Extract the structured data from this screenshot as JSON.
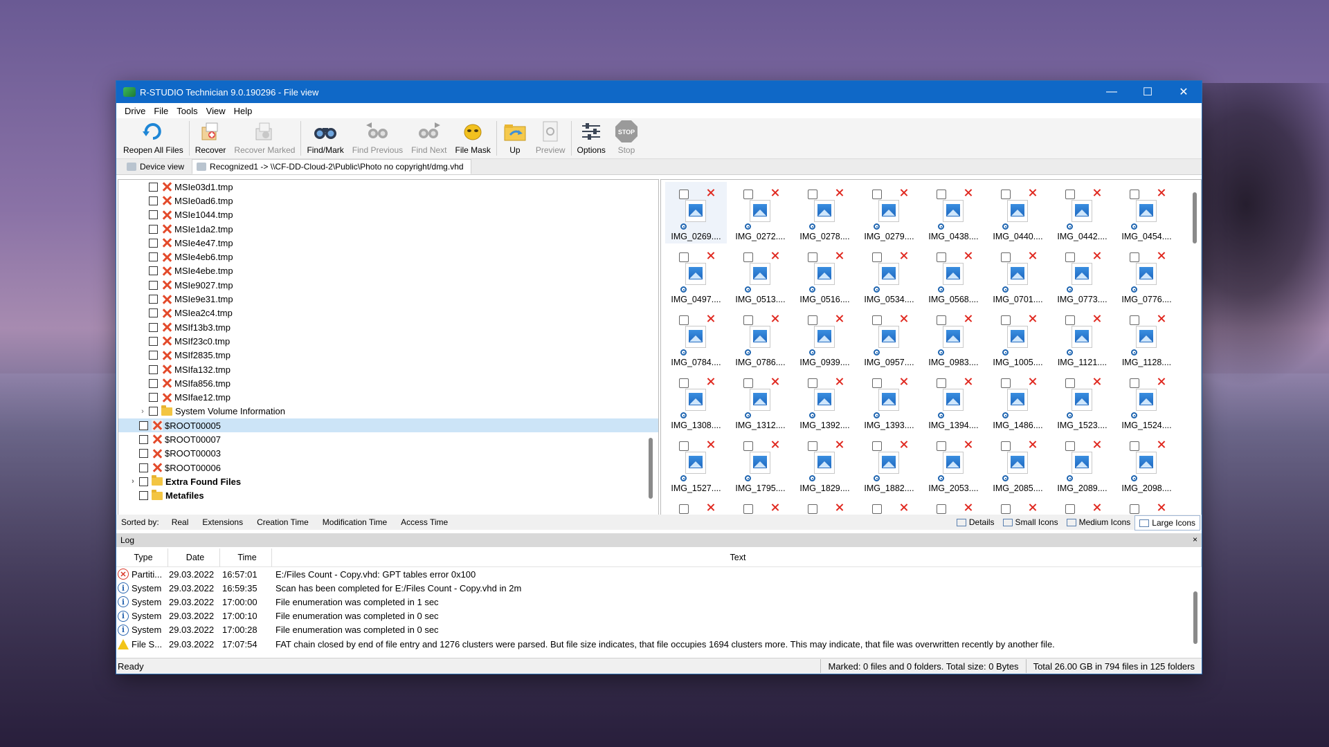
{
  "window": {
    "title": "R-STUDIO Technician 9.0.190296 - File view",
    "controls": {
      "minimize": "—",
      "maximize": "☐",
      "close": "✕"
    }
  },
  "menu": [
    "Drive",
    "File",
    "Tools",
    "View",
    "Help"
  ],
  "toolbar": [
    {
      "label": "Reopen All Files",
      "icon": "refresh-icon",
      "enabled": true
    },
    {
      "label": "Recover",
      "icon": "recover-icon",
      "enabled": true
    },
    {
      "label": "Recover Marked",
      "icon": "recover-marked-icon",
      "enabled": false
    },
    {
      "label": "Find/Mark",
      "icon": "binoculars-icon",
      "enabled": true
    },
    {
      "label": "Find Previous",
      "icon": "find-previous-icon",
      "enabled": false
    },
    {
      "label": "Find Next",
      "icon": "find-next-icon",
      "enabled": false
    },
    {
      "label": "File Mask",
      "icon": "file-mask-icon",
      "enabled": true
    },
    {
      "label": "Up",
      "icon": "folder-up-icon",
      "enabled": true
    },
    {
      "label": "Preview",
      "icon": "preview-icon",
      "enabled": false
    },
    {
      "label": "Options",
      "icon": "options-icon",
      "enabled": true
    },
    {
      "label": "Stop",
      "icon": "stop-icon",
      "enabled": false,
      "icon_text": "STOP"
    }
  ],
  "tabs": [
    {
      "label": "Device view",
      "active": false
    },
    {
      "label": "Recognized1 -> \\\\CF-DD-Cloud-2\\Public\\Photo no copyright/dmg.vhd",
      "active": true
    }
  ],
  "tree": [
    {
      "name": "MSIe03d1.tmp",
      "indent": 2,
      "kind": "deleted"
    },
    {
      "name": "MSIe0ad6.tmp",
      "indent": 2,
      "kind": "deleted"
    },
    {
      "name": "MSIe1044.tmp",
      "indent": 2,
      "kind": "deleted"
    },
    {
      "name": "MSIe1da2.tmp",
      "indent": 2,
      "kind": "deleted"
    },
    {
      "name": "MSIe4e47.tmp",
      "indent": 2,
      "kind": "deleted"
    },
    {
      "name": "MSIe4eb6.tmp",
      "indent": 2,
      "kind": "deleted"
    },
    {
      "name": "MSIe4ebe.tmp",
      "indent": 2,
      "kind": "deleted"
    },
    {
      "name": "MSIe9027.tmp",
      "indent": 2,
      "kind": "deleted"
    },
    {
      "name": "MSIe9e31.tmp",
      "indent": 2,
      "kind": "deleted"
    },
    {
      "name": "MSIea2c4.tmp",
      "indent": 2,
      "kind": "deleted"
    },
    {
      "name": "MSIf13b3.tmp",
      "indent": 2,
      "kind": "deleted"
    },
    {
      "name": "MSIf23c0.tmp",
      "indent": 2,
      "kind": "deleted"
    },
    {
      "name": "MSIf2835.tmp",
      "indent": 2,
      "kind": "deleted"
    },
    {
      "name": "MSIfa132.tmp",
      "indent": 2,
      "kind": "deleted"
    },
    {
      "name": "MSIfa856.tmp",
      "indent": 2,
      "kind": "deleted"
    },
    {
      "name": "MSIfae12.tmp",
      "indent": 2,
      "kind": "deleted"
    },
    {
      "name": "System Volume Information",
      "indent": 2,
      "kind": "folder",
      "expandable": true
    },
    {
      "name": "$ROOT00005",
      "indent": 1,
      "kind": "deleted-doc",
      "selected": true
    },
    {
      "name": "$ROOT00007",
      "indent": 1,
      "kind": "deleted"
    },
    {
      "name": "$ROOT00003",
      "indent": 1,
      "kind": "deleted"
    },
    {
      "name": "$ROOT00006",
      "indent": 1,
      "kind": "deleted"
    },
    {
      "name": "Extra Found Files",
      "indent": 1,
      "kind": "folder",
      "expandable": true,
      "bold": true
    },
    {
      "name": "Metafiles",
      "indent": 1,
      "kind": "folder",
      "bold": true
    }
  ],
  "thumbnails": [
    "IMG_0269....",
    "IMG_0272....",
    "IMG_0278....",
    "IMG_0279....",
    "IMG_0438....",
    "IMG_0440....",
    "IMG_0442....",
    "IMG_0454....",
    "IMG_0497....",
    "IMG_0513....",
    "IMG_0516....",
    "IMG_0534....",
    "IMG_0568....",
    "IMG_0701....",
    "IMG_0773....",
    "IMG_0776....",
    "IMG_0784....",
    "IMG_0786....",
    "IMG_0939....",
    "IMG_0957....",
    "IMG_0983....",
    "IMG_1005....",
    "IMG_1121....",
    "IMG_1128....",
    "IMG_1308....",
    "IMG_1312....",
    "IMG_1392....",
    "IMG_1393....",
    "IMG_1394....",
    "IMG_1486....",
    "IMG_1523....",
    "IMG_1524....",
    "IMG_1527....",
    "IMG_1795....",
    "IMG_1829....",
    "IMG_1882....",
    "IMG_2053....",
    "IMG_2085....",
    "IMG_2089....",
    "IMG_2098....",
    "",
    "",
    "",
    "",
    "",
    "",
    "",
    ""
  ],
  "sort": {
    "label": "Sorted by:",
    "options": [
      "Real",
      "Extensions",
      "Creation Time",
      "Modification Time",
      "Access Time"
    ]
  },
  "views": [
    {
      "label": "Details",
      "active": false
    },
    {
      "label": "Small Icons",
      "active": false
    },
    {
      "label": "Medium Icons",
      "active": false
    },
    {
      "label": "Large Icons",
      "active": true
    }
  ],
  "log": {
    "title": "Log",
    "close": "×",
    "columns": [
      "Type",
      "Date",
      "Time",
      "Text"
    ],
    "rows": [
      {
        "icon": "error",
        "type": "Partiti...",
        "date": "29.03.2022",
        "time": "16:57:01",
        "text": "E:/Files Count - Copy.vhd: GPT tables error 0x100"
      },
      {
        "icon": "info",
        "type": "System",
        "date": "29.03.2022",
        "time": "16:59:35",
        "text": "Scan has been completed for E:/Files Count - Copy.vhd in 2m"
      },
      {
        "icon": "info",
        "type": "System",
        "date": "29.03.2022",
        "time": "17:00:00",
        "text": "File enumeration was completed in 1 sec"
      },
      {
        "icon": "info",
        "type": "System",
        "date": "29.03.2022",
        "time": "17:00:10",
        "text": "File enumeration was completed in 0 sec"
      },
      {
        "icon": "info",
        "type": "System",
        "date": "29.03.2022",
        "time": "17:00:28",
        "text": "File enumeration was completed in 0 sec"
      },
      {
        "icon": "warn",
        "type": "File S...",
        "date": "29.03.2022",
        "time": "17:07:54",
        "text": "FAT chain closed by end of file entry and 1276 clusters were parsed. But file size indicates, that file occupies 1694 clusters more.  This may indicate, that file was overwritten recently by another file."
      }
    ]
  },
  "status": {
    "ready": "Ready",
    "marked": "Marked: 0 files and 0 folders. Total size: 0 Bytes",
    "total": "Total 26.00 GB in 794 files in 125 folders"
  }
}
